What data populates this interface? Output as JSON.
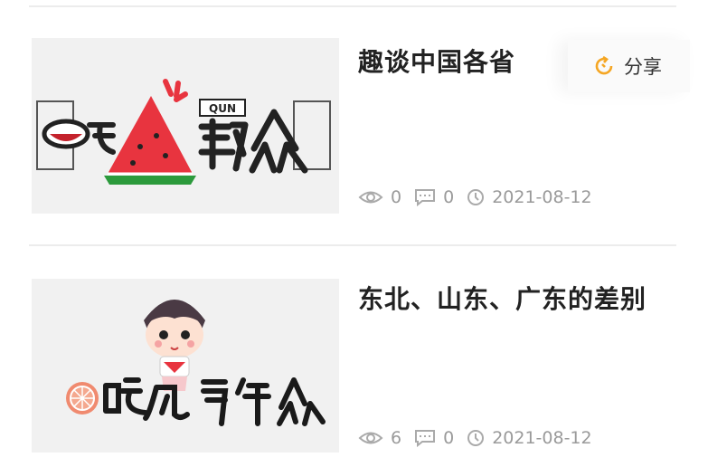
{
  "articles": [
    {
      "title": "趣谈中国各省",
      "logo_text": "QUN",
      "views": "0",
      "comments": "0",
      "date": "2021-08-12"
    },
    {
      "title": "东北、山东、广东的差别",
      "views": "6",
      "comments": "0",
      "date": "2021-08-12"
    }
  ],
  "share": {
    "label": "分享",
    "icon": "share-icon"
  },
  "colors": {
    "accent": "#f5a623",
    "watermelon_red": "#e8343f",
    "rind_green": "#2c9a3c"
  }
}
